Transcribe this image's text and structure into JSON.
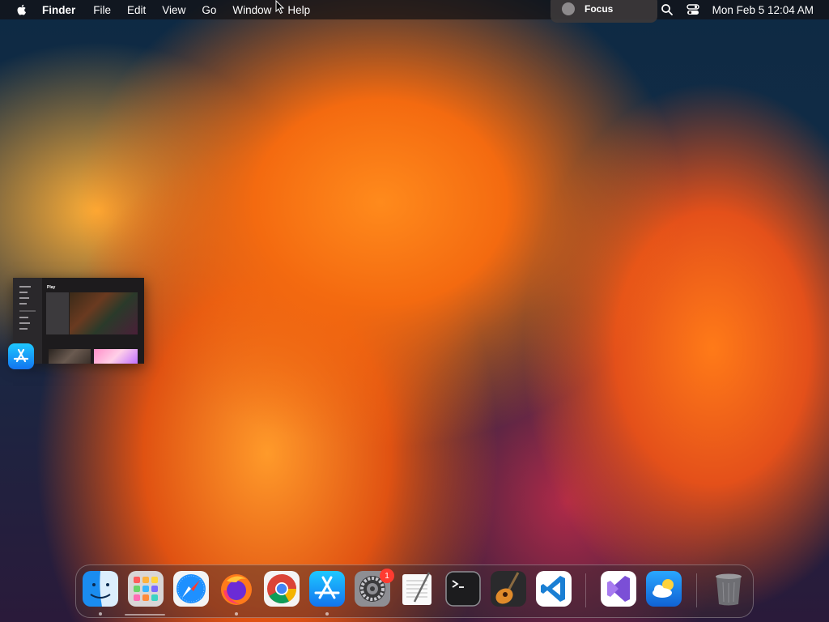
{
  "menubar": {
    "app_name": "Finder",
    "items": [
      "File",
      "Edit",
      "View",
      "Go",
      "Window",
      "Help"
    ],
    "clock": "Mon Feb 5  12:04 AM"
  },
  "focus": {
    "label": "Focus"
  },
  "preview": {
    "title": "Play",
    "app_icon": "app-store-icon"
  },
  "dock": {
    "items": [
      {
        "name": "finder",
        "icon": "finder-icon",
        "running": true
      },
      {
        "name": "launchpad",
        "icon": "launchpad-icon",
        "running": false
      },
      {
        "name": "safari",
        "icon": "safari-icon",
        "running": false
      },
      {
        "name": "firefox",
        "icon": "firefox-icon",
        "running": true
      },
      {
        "name": "chrome",
        "icon": "chrome-icon",
        "running": false
      },
      {
        "name": "app-store",
        "icon": "app-store-icon",
        "running": true
      },
      {
        "name": "system-settings",
        "icon": "gear-icon",
        "running": false
      },
      {
        "name": "textedit",
        "icon": "textedit-icon",
        "running": false
      },
      {
        "name": "terminal",
        "icon": "terminal-icon",
        "running": false
      },
      {
        "name": "garageband",
        "icon": "guitar-icon",
        "running": false
      },
      {
        "name": "vscode",
        "icon": "vscode-icon",
        "running": false
      },
      {
        "name": "visual-studio",
        "icon": "visual-studio-icon",
        "running": false
      },
      {
        "name": "weather",
        "icon": "weather-icon",
        "running": false
      },
      {
        "name": "trash",
        "icon": "trash-icon",
        "running": false
      }
    ],
    "badge_count": "1"
  },
  "colors": {
    "menubar": "#141012",
    "badge": "#ff3b30",
    "accent": "#1274f0"
  }
}
